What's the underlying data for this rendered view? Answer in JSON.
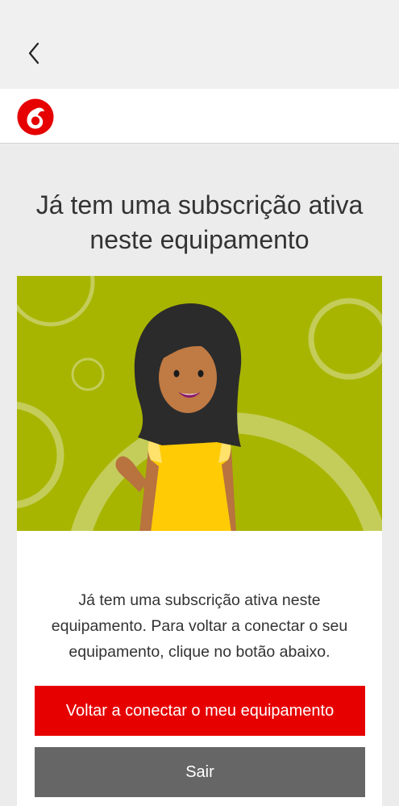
{
  "icons": {
    "back": "chevron-left-icon",
    "logo": "vodafone-logo"
  },
  "colors": {
    "brand_red": "#e60000",
    "secondary_button": "#666666",
    "hero_green": "#a8b500"
  },
  "main": {
    "heading": "Já tem uma subscrição ativa neste equipamento",
    "message": "Já tem uma subscrição ativa neste equipamento. Para voltar a conectar o seu equipamento, clique no botão abaixo.",
    "primary_button": "Voltar a conectar o meu equipamento",
    "secondary_button": "Sair"
  }
}
